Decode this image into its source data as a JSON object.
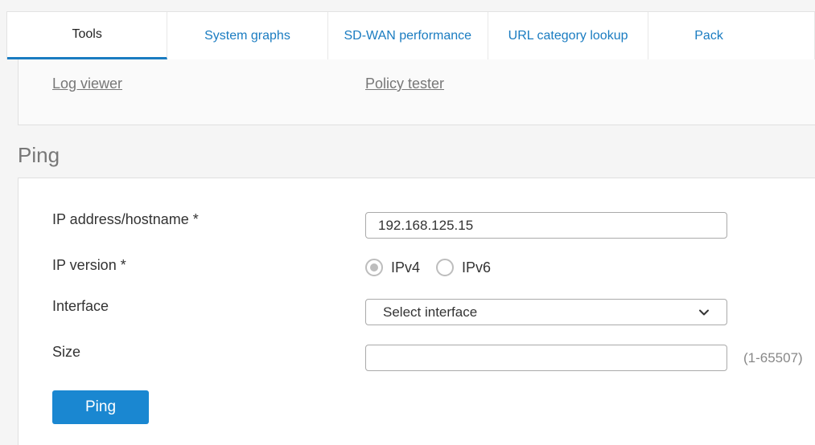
{
  "tabs": [
    {
      "label": "Tools",
      "active": true
    },
    {
      "label": "System graphs",
      "active": false
    },
    {
      "label": "SD-WAN performance",
      "active": false
    },
    {
      "label": "URL category lookup",
      "active": false
    },
    {
      "label": "Pack",
      "active": false
    }
  ],
  "links": {
    "log_viewer": "Log viewer",
    "policy_tester": "Policy tester"
  },
  "ping": {
    "title": "Ping",
    "ip_label": "IP address/hostname *",
    "ip_value": "192.168.125.15",
    "version_label": "IP version *",
    "ipv4_label": "IPv4",
    "ipv6_label": "IPv6",
    "interface_label": "Interface",
    "interface_value": "Select interface",
    "size_label": "Size",
    "size_value": "",
    "size_hint": "(1-65507)",
    "button_label": "Ping"
  },
  "colors": {
    "accent": "#1a87d1",
    "tab_link": "#1a7cc1"
  },
  "icons": {
    "select_arrow": "chevron-down-icon"
  }
}
